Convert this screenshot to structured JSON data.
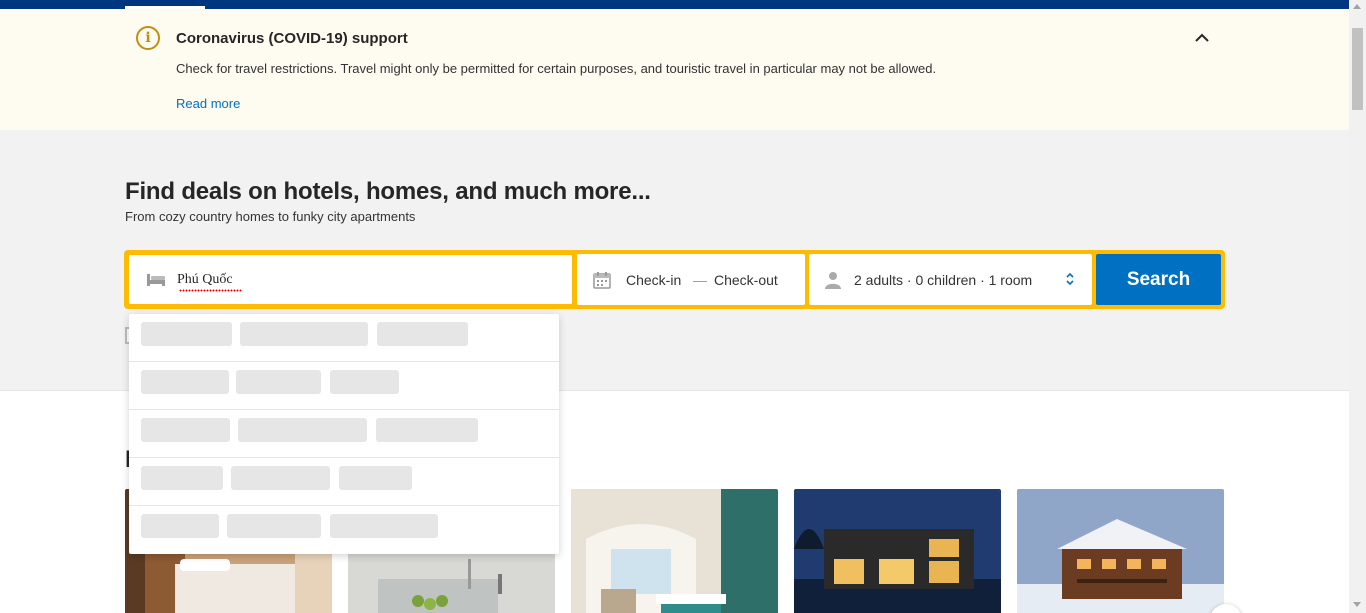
{
  "covid_banner": {
    "title": "Coronavirus (COVID-19) support",
    "body": "Check for travel restrictions. Travel might only be permitted for certain purposes, and touristic travel in particular may not be allowed.",
    "read_more": "Read more",
    "icon": "info-icon",
    "collapse_icon": "chevron-up-icon"
  },
  "hero": {
    "headline": "Find deals on hotels, homes, and much more...",
    "subheadline": "From cozy country homes to funky city apartments"
  },
  "search_form": {
    "destination_value": "Phú Quốc",
    "checkin_label": "Check-in",
    "date_separator": "—",
    "checkout_label": "Check-out",
    "guests_summary": "2 adults · 0 children · 1 room",
    "search_label": "Search",
    "colors": {
      "frame": "#febb02",
      "button": "#0071c2"
    }
  },
  "autocomplete": {
    "state": "loading",
    "row_count": 5
  },
  "section": {
    "partial_heading": "I"
  },
  "colors": {
    "brand_dark": "#003580",
    "link": "#0071c2",
    "banner_bg": "#fefbf0",
    "warning": "#c08e12"
  }
}
